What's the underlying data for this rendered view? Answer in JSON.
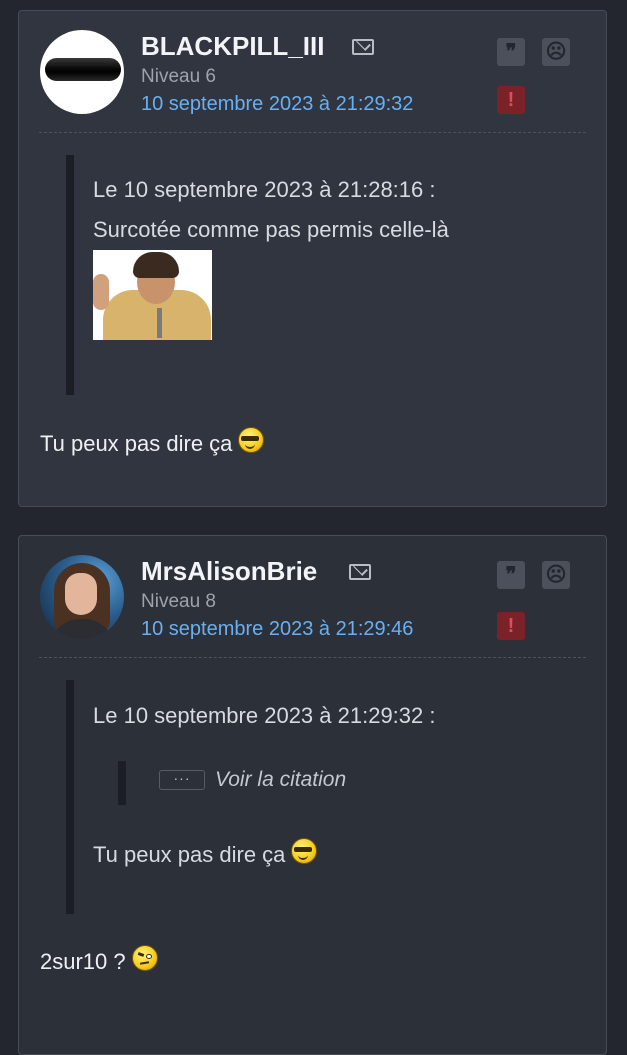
{
  "posts": [
    {
      "username": "BLACKPILL_III",
      "level": "Niveau 6",
      "date": "10 septembre 2023 à 21:29:32",
      "quote": {
        "header": "Le 10 septembre 2023 à 21:28:16 :",
        "text": "Surcotée comme pas permis celle-là"
      },
      "message": "Tu peux pas dire ça"
    },
    {
      "username": "MrsAlisonBrie",
      "level": "Niveau 8",
      "date": "10 septembre 2023 à 21:29:46",
      "quote": {
        "header": "Le 10 septembre 2023 à 21:29:32 :",
        "nested_button": "···",
        "nested_label": "Voir la citation",
        "text": "Tu peux pas dire ça"
      },
      "message": "2sur10 ?"
    }
  ],
  "icons": {
    "mail": "mail-icon",
    "quote": "quote-icon",
    "sad": "sad-face-icon",
    "alert": "alert-icon",
    "quote_glyph": "❞",
    "alert_glyph": "!",
    "sad_glyph": "☹"
  },
  "colors": {
    "background": "#23262e",
    "card": "#303540",
    "date_link": "#6aaff0",
    "alert": "#7a2228"
  }
}
